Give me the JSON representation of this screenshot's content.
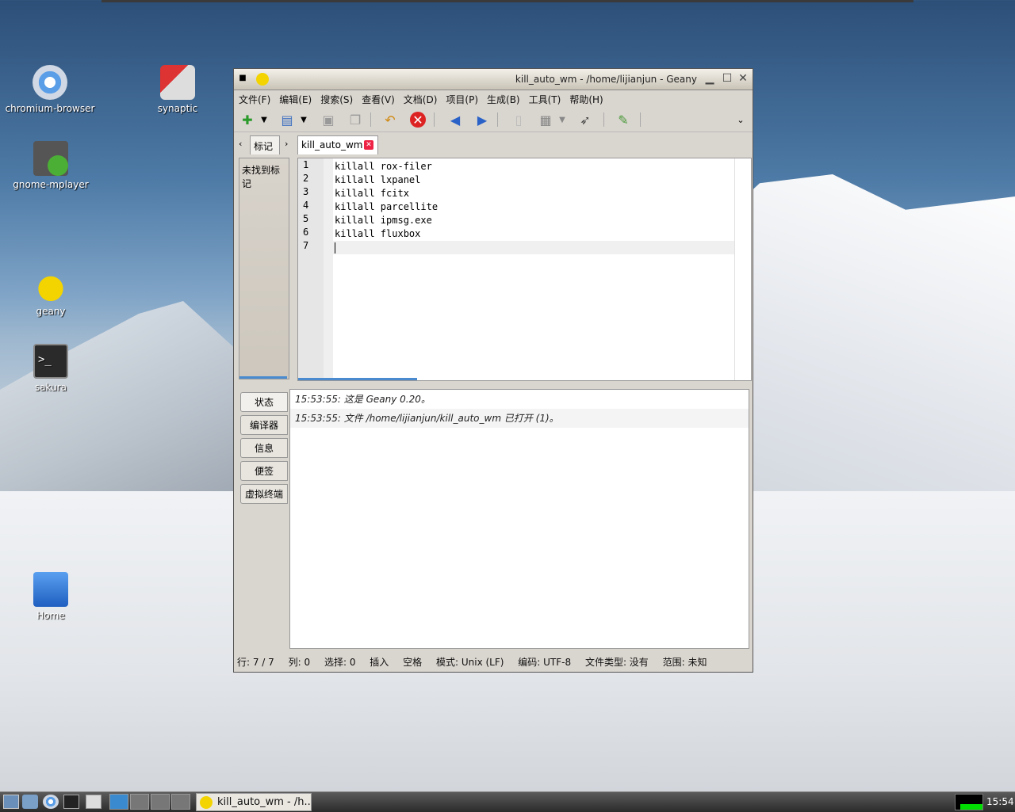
{
  "desktop": {
    "icons": [
      {
        "label": "chromium-browser",
        "icon": "chromium-icon"
      },
      {
        "label": "synaptic",
        "icon": "synaptic-icon"
      },
      {
        "label": "gnome-mplayer",
        "icon": "mplayer-icon"
      },
      {
        "label": "geany",
        "icon": "geany-icon"
      },
      {
        "label": "sakura",
        "icon": "terminal-icon"
      },
      {
        "label": "Home",
        "icon": "folder-icon"
      }
    ]
  },
  "window": {
    "title": "kill_auto_wm - /home/lijianjun - Geany",
    "menu": [
      "文件(F)",
      "编辑(E)",
      "搜索(S)",
      "查看(V)",
      "文档(D)",
      "项目(P)",
      "生成(B)",
      "工具(T)",
      "帮助(H)"
    ],
    "sidebar": {
      "tab_label": "标记",
      "empty_text": "未找到标记"
    },
    "editor": {
      "tab_label": "kill_auto_wm",
      "line_numbers": [
        "1",
        "2",
        "3",
        "4",
        "5",
        "6",
        "7"
      ],
      "lines": [
        "killall rox-filer",
        "killall lxpanel",
        "killall fcitx",
        "killall parcellite",
        "killall ipmsg.exe",
        "killall fluxbox",
        ""
      ]
    },
    "message_tabs": [
      "状态",
      "编译器",
      "信息",
      "便签",
      "虚拟终端"
    ],
    "messages": [
      "15:53:55: 这是 Geany 0.20。",
      "15:53:55: 文件 /home/lijianjun/kill_auto_wm 已打开 (1)。"
    ],
    "status": {
      "position": "行: 7 / 7",
      "column": "列: 0",
      "selection": "选择: 0",
      "mode_insert": "插入",
      "indent": "空格",
      "eol": "模式: Unix (LF)",
      "encoding": "编码: UTF-8",
      "filetype": "文件类型: 没有",
      "scope": "范围: 未知"
    }
  },
  "taskbar": {
    "task_label": "kill_auto_wm - /h...",
    "clock": "15:54"
  }
}
